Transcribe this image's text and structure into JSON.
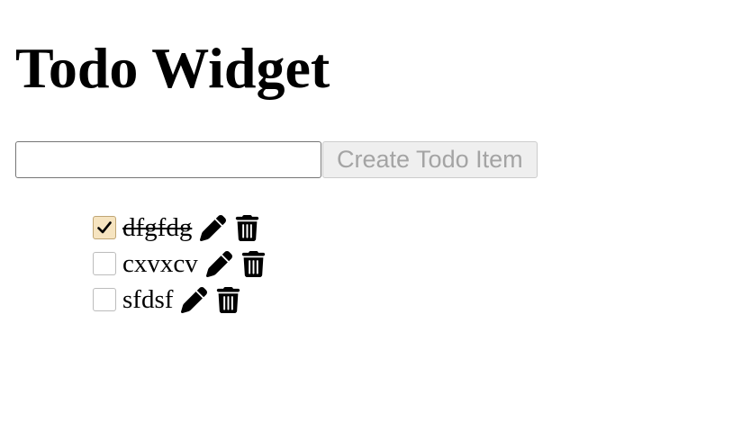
{
  "header": {
    "title": "Todo Widget"
  },
  "new_todo": {
    "input_value": "",
    "placeholder": "",
    "create_label": "Create Todo Item",
    "create_disabled": true
  },
  "todos": [
    {
      "text": "dfgfdg",
      "completed": true,
      "edit_icon": "pencil-icon",
      "delete_icon": "trash-icon"
    },
    {
      "text": "cxvxcv",
      "completed": false,
      "edit_icon": "pencil-icon",
      "delete_icon": "trash-icon"
    },
    {
      "text": "sfdsf",
      "completed": false,
      "edit_icon": "pencil-icon",
      "delete_icon": "trash-icon"
    }
  ],
  "colors": {
    "checked_fill": "#f6e4c0",
    "disabled_button_bg": "#efefef",
    "disabled_button_text": "#a4a4a4"
  }
}
